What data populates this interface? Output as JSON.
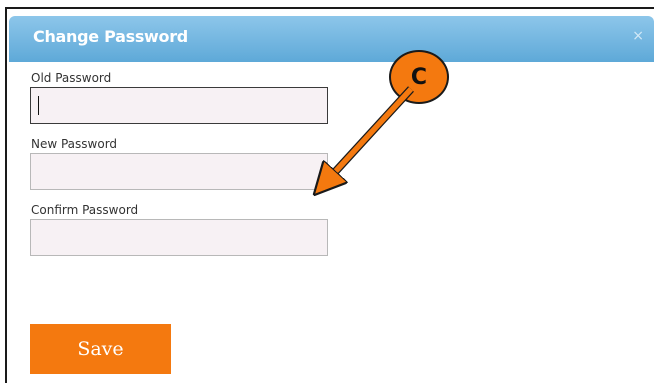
{
  "dialog": {
    "title": "Change Password",
    "close_glyph": "×"
  },
  "form": {
    "old_password_label": "Old Password",
    "old_password_value": "",
    "new_password_label": "New Password",
    "new_password_value": "",
    "confirm_password_label": "Confirm Password",
    "confirm_password_value": "",
    "save_label": "Save"
  },
  "annotation": {
    "marker_letter": "C"
  },
  "colors": {
    "titlebar": "#6fb3df",
    "accent": "#f4790f",
    "field_background": "#f7f1f4"
  }
}
